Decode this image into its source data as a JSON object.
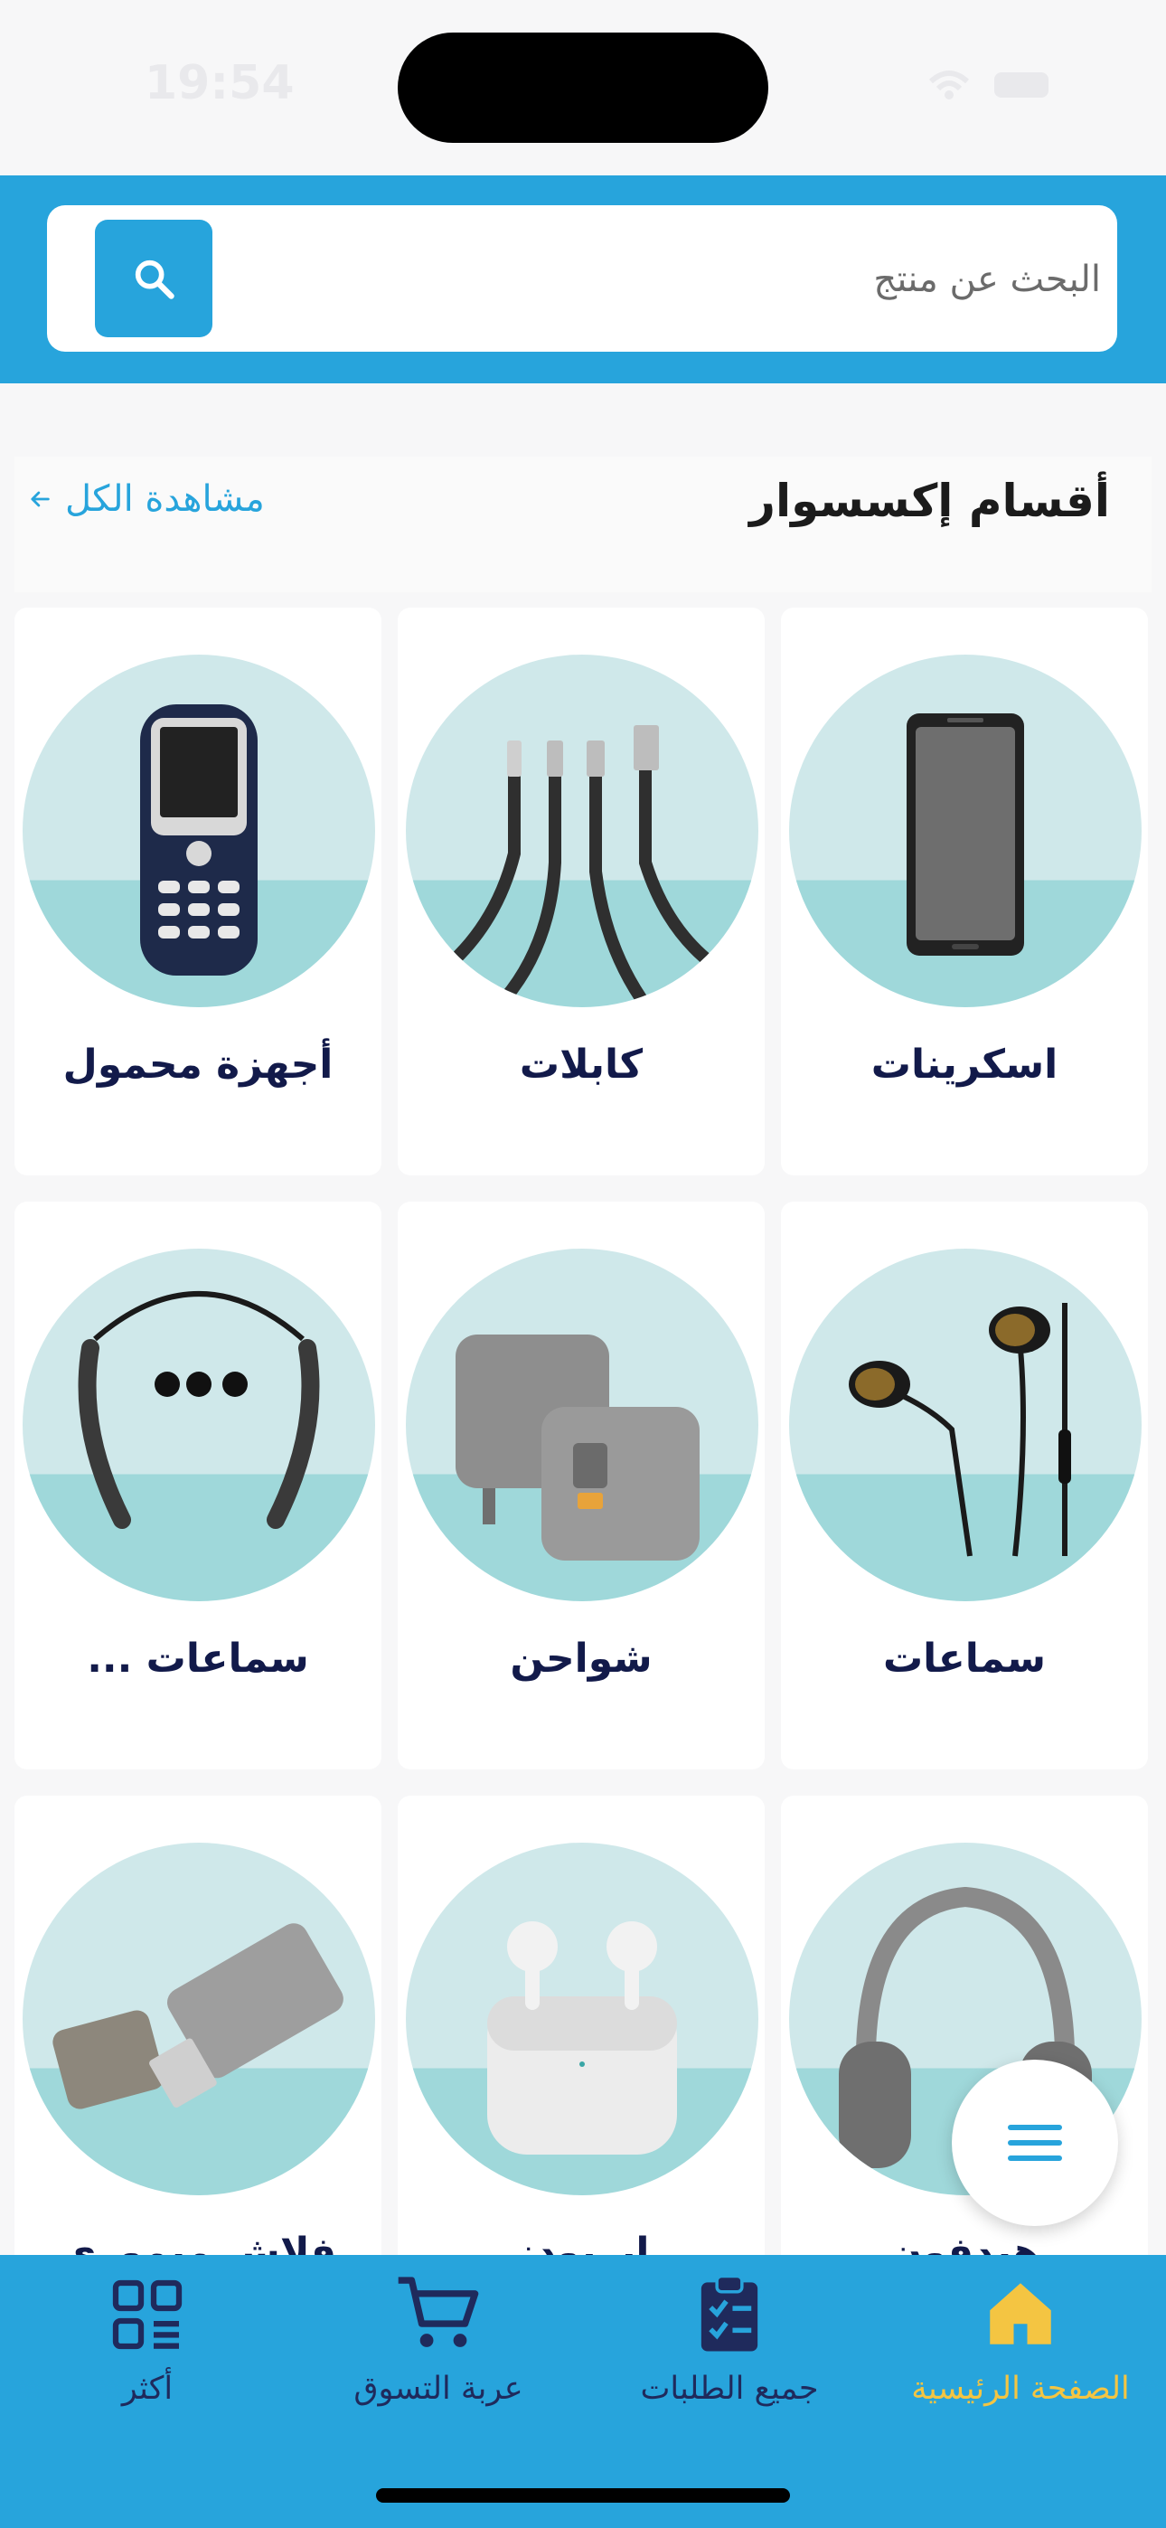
{
  "status_bar": {
    "time": "19:54"
  },
  "search": {
    "placeholder": "البحث عن منتج"
  },
  "section": {
    "title": "أقسام إكسسوار",
    "see_all": "مشاهدة الكل"
  },
  "categories": [
    {
      "label": "اسكرينات",
      "icon": "screen-protector-image"
    },
    {
      "label": "كابلات",
      "icon": "cables-image"
    },
    {
      "label": "أجهزة محمول",
      "icon": "mobile-phone-image"
    },
    {
      "label": "سماعات",
      "icon": "earphones-image"
    },
    {
      "label": "شواحن",
      "icon": "chargers-image"
    },
    {
      "label": "سماعات ...",
      "icon": "neckband-headset-image"
    },
    {
      "label": "هيدفون",
      "icon": "headphones-image"
    },
    {
      "label": "ايربودز",
      "icon": "airpods-image"
    },
    {
      "label": "فلاش ميموري",
      "icon": "usb-flash-image"
    }
  ],
  "tabbar": {
    "home": "الصفحة الرئيسية",
    "orders": "جميع الطلبات",
    "cart": "عربة التسوق",
    "more": "أكثر"
  },
  "colors": {
    "primary": "#27a4dc",
    "active_tab": "#f4c542",
    "tab_text": "#1f2a5c",
    "title_text": "#121a4a"
  }
}
